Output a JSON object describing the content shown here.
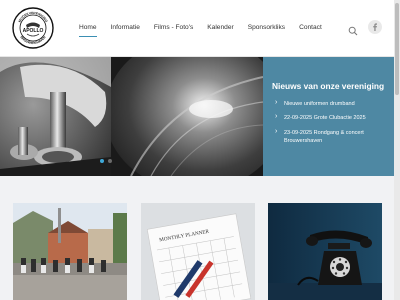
{
  "logo": {
    "ring_text_top": "MUZIEKVERENIGING",
    "name": "APOLLO",
    "ring_text_bottom": "BROUWERSHAVEN"
  },
  "nav": {
    "items": [
      {
        "label": "Home",
        "active": true
      },
      {
        "label": "Informatie",
        "active": false
      },
      {
        "label": "Films - Foto's",
        "active": false
      },
      {
        "label": "Kalender",
        "active": false
      },
      {
        "label": "Sponsorkliks",
        "active": false
      },
      {
        "label": "Contact",
        "active": false
      }
    ]
  },
  "icons": {
    "search": "search-icon",
    "facebook": "facebook-icon"
  },
  "hero": {
    "news_title": "Nieuws van onze vereniging",
    "news_items": [
      "Nieuwe uniformen drumband",
      "22-09-2025 Grote Clubactie 2025",
      "23-09-2025 Rondgang & concert Brouwershaven"
    ],
    "slides": 2,
    "active_slide": 1
  },
  "cards": {
    "planner_title": "MONTHLY PLANNER"
  },
  "colors": {
    "accent": "#3b8fb3",
    "news_panel": "#4e88a3",
    "background": "#f1f2f4"
  }
}
